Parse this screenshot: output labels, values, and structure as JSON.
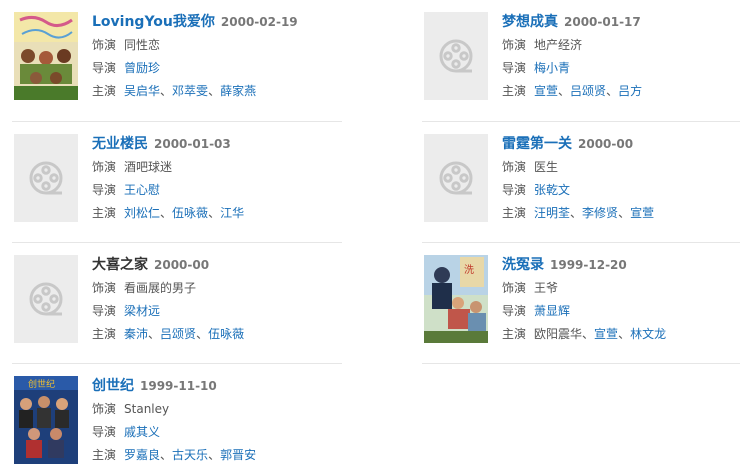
{
  "labels": {
    "role": "饰演",
    "director": "导演",
    "cast": "主演"
  },
  "items": [
    {
      "title": "LovingYou我爱你",
      "date": "2000-02-19",
      "role": "同性恋",
      "director": "曾励珍",
      "cast": [
        "吴启华",
        "邓萃雯",
        "薛家燕"
      ],
      "poster": "photo"
    },
    {
      "title": "梦想成真",
      "date": "2000-01-17",
      "role": "地产经济",
      "director": "梅小青",
      "cast": [
        "宣萱",
        "吕颂贤",
        "吕方"
      ],
      "poster": "placeholder"
    },
    {
      "title": "无业楼民",
      "date": "2000-01-03",
      "role": "酒吧球迷",
      "director": "王心慰",
      "cast": [
        "刘松仁",
        "伍咏薇",
        "江华"
      ],
      "poster": "placeholder"
    },
    {
      "title": "雷霆第一关",
      "date": "2000-00",
      "role": "医生",
      "director": "张乾文",
      "cast": [
        "汪明荃",
        "李修贤",
        "宣萱"
      ],
      "poster": "placeholder"
    },
    {
      "title": "大喜之家",
      "date": "2000-00",
      "role": "看画展的男子",
      "director": "梁材远",
      "cast": [
        "秦沛",
        "吕颂贤",
        "伍咏薇"
      ],
      "poster": "placeholder"
    },
    {
      "title": "洗冤录",
      "date": "1999-12-20",
      "role": "王爷",
      "director": "萧显辉",
      "cast": [
        "欧阳震华",
        "宣萱",
        "林文龙"
      ],
      "poster": "photo"
    },
    {
      "title": "创世纪",
      "date": "1999-11-10",
      "role": "Stanley",
      "director": "戚其义",
      "cast": [
        "罗嘉良",
        "古天乐",
        "郭晋安"
      ],
      "poster": "photo"
    }
  ],
  "cast_separator": "、",
  "plain_cast": [
    [],
    [],
    [],
    [],
    [],
    [
      0
    ],
    []
  ],
  "colors": {
    "link": "#1a6fb8",
    "placeholder_bg": "#ececec",
    "placeholder_icon": "#c8c8c8"
  }
}
